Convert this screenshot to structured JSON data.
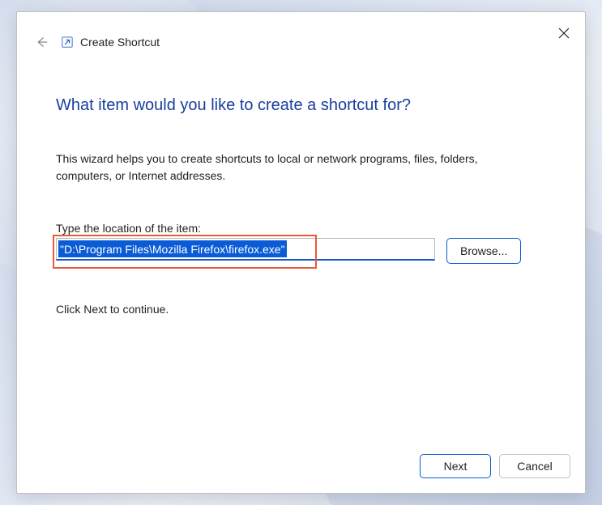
{
  "header": {
    "title": "Create Shortcut"
  },
  "content": {
    "heading": "What item would you like to create a shortcut for?",
    "description": "This wizard helps you to create shortcuts to local or network programs, files, folders, computers, or Internet addresses.",
    "input_label": "Type the location of the item:",
    "input_value": "\"D:\\Program Files\\Mozilla Firefox\\firefox.exe\"",
    "browse_label": "Browse...",
    "continue_hint": "Click Next to continue."
  },
  "footer": {
    "next_label": "Next",
    "cancel_label": "Cancel"
  },
  "colors": {
    "accent": "#1a3e9e",
    "selection": "#0a5bd6",
    "highlight": "#e85a3a"
  }
}
